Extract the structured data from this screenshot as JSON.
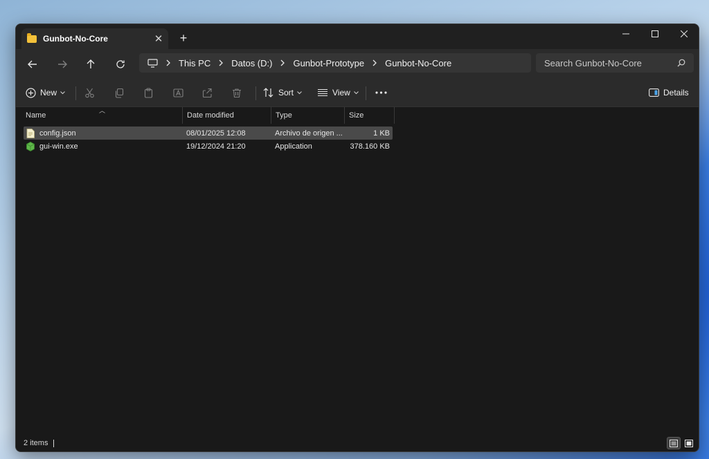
{
  "window": {
    "tab_title": "Gunbot-No-Core",
    "new_tab_glyph": "+",
    "close_glyph": "✕"
  },
  "breadcrumb": [
    "This PC",
    "Datos (D:)",
    "Gunbot-Prototype",
    "Gunbot-No-Core"
  ],
  "search": {
    "placeholder": "Search Gunbot-No-Core"
  },
  "commandbar": {
    "new_label": "New",
    "sort_label": "Sort",
    "view_label": "View",
    "details_label": "Details"
  },
  "columns": {
    "name": "Name",
    "date": "Date modified",
    "type": "Type",
    "size": "Size"
  },
  "files": [
    {
      "name": "config.json",
      "date": "08/01/2025 12:08",
      "type": "Archivo de origen ...",
      "size": "1 KB",
      "icon": "json-file-icon",
      "selected": true
    },
    {
      "name": "gui-win.exe",
      "date": "19/12/2024 21:20",
      "type": "Application",
      "size": "378.160 KB",
      "icon": "exe-file-icon",
      "selected": false
    }
  ],
  "status": {
    "item_count": "2 items"
  },
  "colors": {
    "folder": "#f3c13a",
    "window_bg": "#191919",
    "toolbar_bg": "#2b2b2b",
    "selection": "#4a4a4a"
  }
}
